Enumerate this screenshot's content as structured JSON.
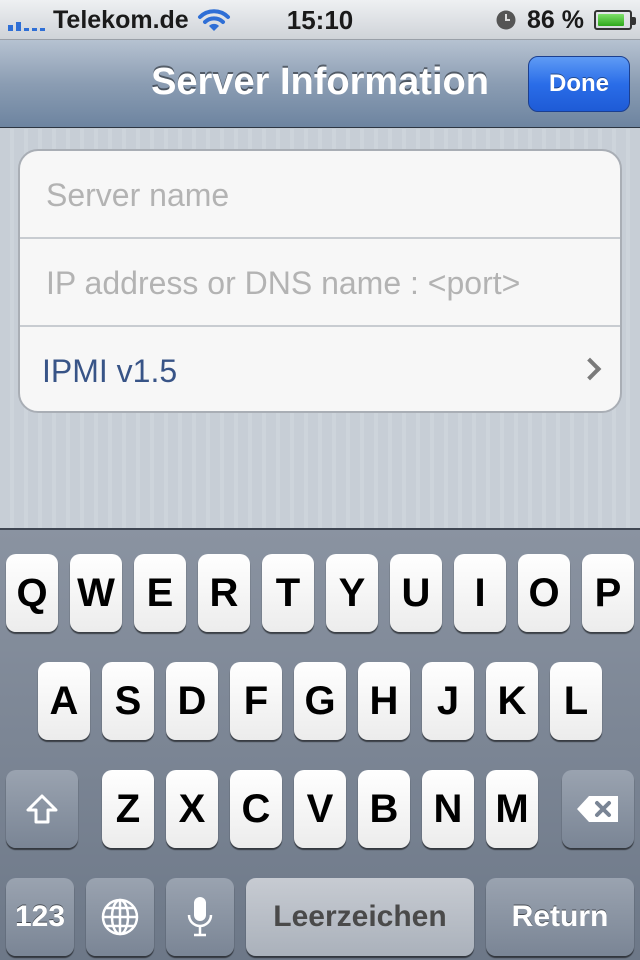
{
  "status_bar": {
    "carrier": "Telekom.de",
    "time": "15:10",
    "battery_percent": "86 %",
    "battery_level": 0.86,
    "icons": [
      "signal-icon",
      "wifi-icon",
      "clock-icon",
      "battery-icon"
    ]
  },
  "nav": {
    "title": "Server Information",
    "done_label": "Done",
    "accent": "#2a6de8"
  },
  "form": {
    "server_name_placeholder": "Server name",
    "address_placeholder": "IP address or DNS name : <port>",
    "protocol_label": "IPMI v1.5"
  },
  "keyboard": {
    "row1": [
      "Q",
      "W",
      "E",
      "R",
      "T",
      "Y",
      "U",
      "I",
      "O",
      "P"
    ],
    "row2": [
      "A",
      "S",
      "D",
      "F",
      "G",
      "H",
      "J",
      "K",
      "L"
    ],
    "row3": [
      "Z",
      "X",
      "C",
      "V",
      "B",
      "N",
      "M"
    ],
    "numbers_label": "123",
    "space_label": "Leerzeichen",
    "return_label": "Return"
  }
}
